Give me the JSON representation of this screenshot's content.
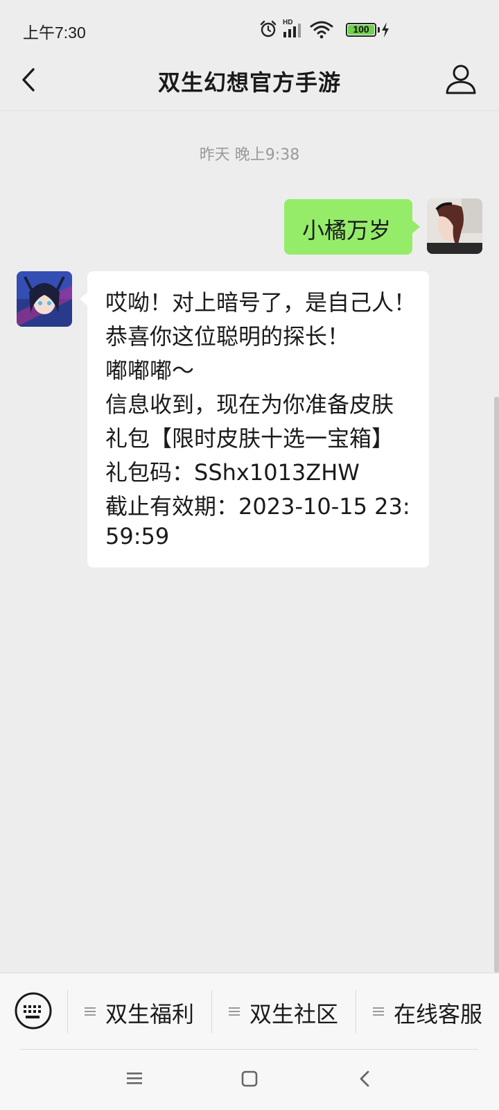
{
  "status_bar": {
    "time": "上午7:30",
    "network_label": "HD",
    "battery": "100",
    "battery_level_percent": 100,
    "icons": [
      "alarm-icon",
      "signal-icon",
      "wifi-icon",
      "battery-icon",
      "charging-icon"
    ]
  },
  "header": {
    "title": "双生幻想官方手游",
    "icons": [
      "back-arrow-icon",
      "profile-icon"
    ]
  },
  "chat": {
    "timestamp": "昨天 晚上9:38",
    "messages": [
      {
        "sender": "me",
        "lines": [
          "小橘万岁"
        ]
      },
      {
        "sender": "official-account",
        "lines": [
          "哎呦！对上暗号了，是自己人！",
          "恭喜你这位聪明的探长！",
          "嘟嘟嘟～",
          "信息收到，现在为你准备皮肤",
          "礼包【限时皮肤十选一宝箱】",
          "礼包码：SShx1013ZHW",
          "截止有效期：2023-10-15 23:",
          "59:59"
        ]
      }
    ],
    "colors": {
      "my_bubble": "#95ec69",
      "their_bubble": "#ffffff",
      "background": "#ededed"
    }
  },
  "bottom_menu": {
    "items": [
      {
        "label": "双生福利"
      },
      {
        "label": "双生社区"
      },
      {
        "label": "在线客服"
      }
    ],
    "icons": [
      "keyboard-icon",
      "menu-lines-icon"
    ]
  },
  "system_nav": {
    "icons": [
      "recent-apps-icon",
      "home-icon",
      "back-icon"
    ]
  }
}
